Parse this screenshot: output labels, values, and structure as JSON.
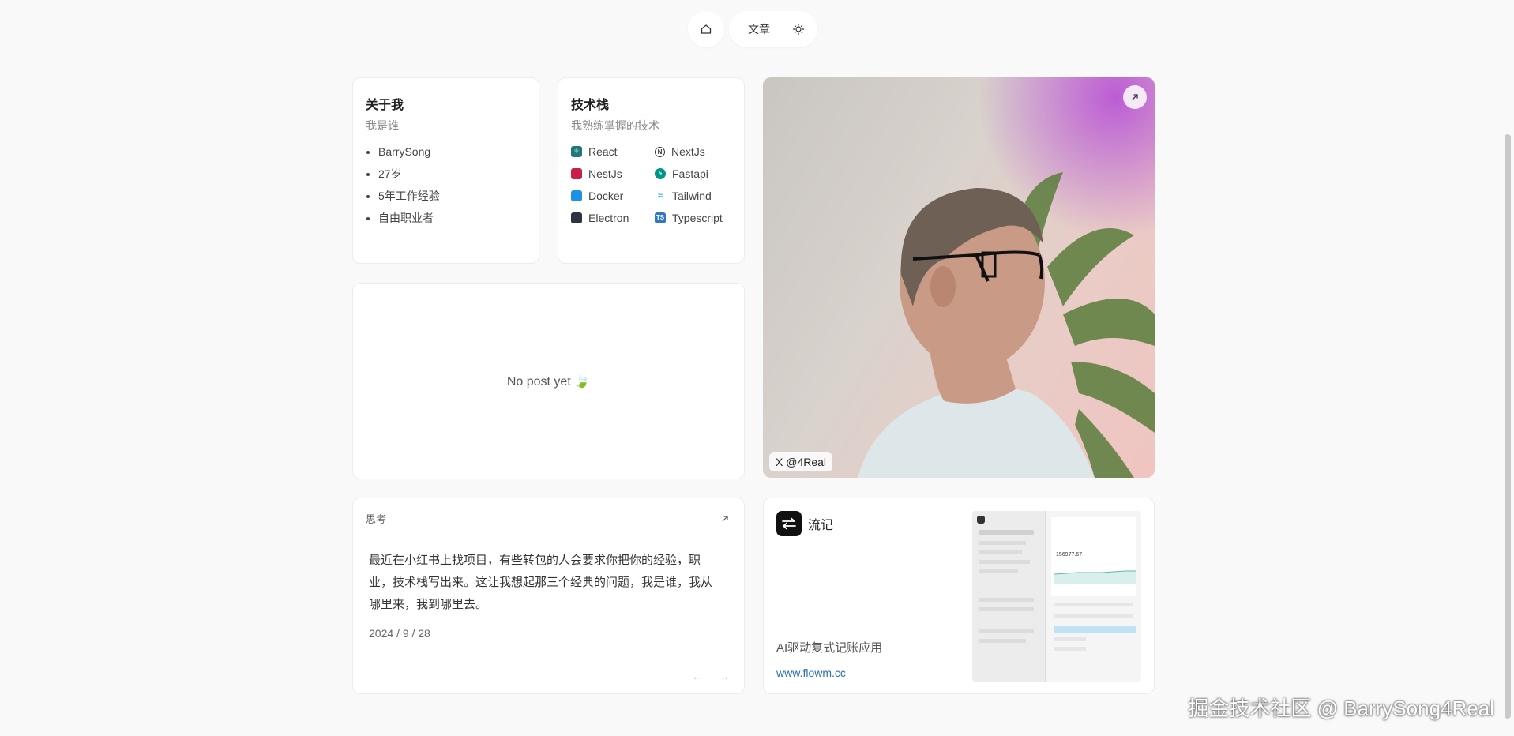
{
  "nav": {
    "articles_label": "文章"
  },
  "about": {
    "title": "关于我",
    "subtitle": "我是谁",
    "items": [
      "BarrySong",
      "27岁",
      "5年工作经验",
      "自由职业者"
    ]
  },
  "tech": {
    "title": "技术栈",
    "subtitle": "我熟练掌握的技术",
    "items": [
      {
        "label": "React",
        "icon": "react-icon",
        "color": "#1e7a7a"
      },
      {
        "label": "NextJs",
        "icon": "nextjs-icon",
        "color": "#222222"
      },
      {
        "label": "NestJs",
        "icon": "nestjs-icon",
        "color": "#c8204a"
      },
      {
        "label": "Fastapi",
        "icon": "fastapi-icon",
        "color": "#009688"
      },
      {
        "label": "Docker",
        "icon": "docker-icon",
        "color": "#1d91e6"
      },
      {
        "label": "Tailwind",
        "icon": "tailwind-icon",
        "color": "#38bdf8"
      },
      {
        "label": "Electron",
        "icon": "electron-icon",
        "color": "#2f3241"
      },
      {
        "label": "Typescript",
        "icon": "typescript-icon",
        "color": "#3178c6"
      }
    ]
  },
  "posts": {
    "empty_text": "No post yet 🍃"
  },
  "photo": {
    "caption": "X @4Real"
  },
  "thought": {
    "label": "思考",
    "body": "最近在小红书上找项目，有些转包的人会要求你把你的经验，职业，技术栈写出来。这让我想起那三个经典的问题，我是谁，我从哪里来，我到哪里去。",
    "date": "2024 / 9 / 28",
    "prev": "←",
    "next": "→"
  },
  "app": {
    "name": "流记",
    "description": "AI驱动复式记账应用",
    "url": "www.flowm.cc",
    "preview_amount": "156977.67"
  },
  "watermark": "掘金技术社区 @ BarrySong4Real"
}
